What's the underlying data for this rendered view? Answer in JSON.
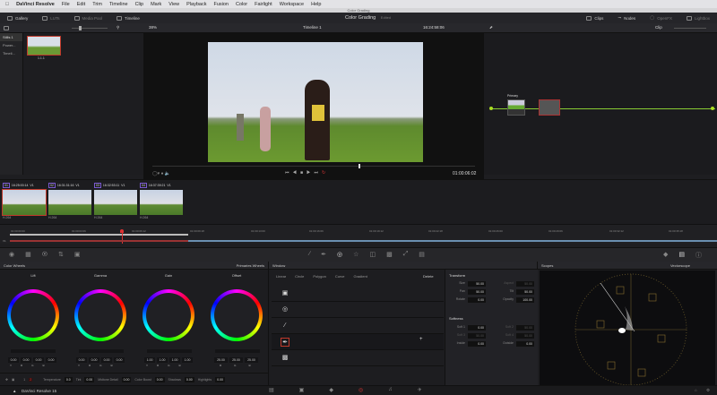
{
  "menu": {
    "app": "DaVinci Resolve",
    "items": [
      "File",
      "Edit",
      "Trim",
      "Timeline",
      "Clip",
      "Mark",
      "View",
      "Playback",
      "Fusion",
      "Color",
      "Fairlight",
      "Workspace",
      "Help"
    ]
  },
  "window_title": "Color Grading",
  "toolbar": {
    "left": [
      "Gallery",
      "LUTs",
      "Media Pool",
      "Timeline"
    ],
    "page_title": "Color Grading",
    "page_status": "Edited",
    "right": [
      "Clips",
      "Nodes",
      "OpenFX",
      "Lightbox"
    ]
  },
  "viewer_bar": {
    "zoom": "38%",
    "timeline": "Timeline 1",
    "timecode": "16:24:58:06",
    "clip_mode": "Clip"
  },
  "gallery": {
    "sidebar": [
      "Stills 1",
      "Power...",
      "Timeli..."
    ],
    "still_label": "1.1.1"
  },
  "viewer": {
    "timecode": "01:00:06:02"
  },
  "nodes": {
    "node1_label": "Primary"
  },
  "clips": [
    {
      "num": "01",
      "tc": "16:25:00:14",
      "track": "V1",
      "codec": "H.264"
    },
    {
      "num": "02",
      "tc": "16:31:31:16",
      "track": "V1",
      "codec": "H.264"
    },
    {
      "num": "03",
      "tc": "16:32:53:11",
      "track": "V1",
      "codec": "H.264"
    },
    {
      "num": "04",
      "tc": "16:37:39:21",
      "track": "V1",
      "codec": "H.264"
    }
  ],
  "ruler": {
    "track": "V1",
    "ticks": [
      "01:00:00:00",
      "01:00:03:06",
      "01:00:06:12",
      "01:00:09:18",
      "01:00:13:00",
      "01:00:16:06",
      "01:00:19:12",
      "01:00:22:18",
      "01:00:26:00",
      "01:00:29:06",
      "01:00:32:12",
      "01:00:35:18"
    ]
  },
  "color_wheels": {
    "title": "Color Wheels",
    "mode": "Primaries Wheels",
    "wheels": [
      {
        "name": "Lift",
        "values": [
          "0.00",
          "0.00",
          "0.00",
          "0.00"
        ],
        "channels": [
          "Y",
          "R",
          "G",
          "B"
        ]
      },
      {
        "name": "Gamma",
        "values": [
          "0.00",
          "0.00",
          "0.00",
          "0.00"
        ],
        "channels": [
          "Y",
          "R",
          "G",
          "B"
        ]
      },
      {
        "name": "Gain",
        "values": [
          "1.00",
          "1.00",
          "1.00",
          "1.00"
        ],
        "channels": [
          "Y",
          "R",
          "G",
          "B"
        ]
      },
      {
        "name": "Offset",
        "values": [
          "25.00",
          "25.00",
          "25.00"
        ],
        "channels": [
          "R",
          "G",
          "B"
        ]
      }
    ],
    "pages": [
      "1",
      "2"
    ],
    "params": [
      {
        "label": "Temperature",
        "value": "0.0"
      },
      {
        "label": "Tint",
        "value": "0.00"
      },
      {
        "label": "Midtone Detail",
        "value": "0.00"
      },
      {
        "label": "Color Boost",
        "value": "0.00"
      },
      {
        "label": "Shadows",
        "value": "0.00"
      },
      {
        "label": "Highlights",
        "value": "0.00"
      }
    ]
  },
  "window_panel": {
    "title": "Window",
    "tools": [
      "Linear",
      "Circle",
      "Polygon",
      "Curve",
      "Gradient"
    ],
    "delete": "Delete",
    "transform_title": "Transform",
    "transform": [
      {
        "label": "Size",
        "value": "50.00"
      },
      {
        "label": "Aspect",
        "value": "50.00"
      },
      {
        "label": "Pan",
        "value": "50.00"
      },
      {
        "label": "Tilt",
        "value": "50.00"
      },
      {
        "label": "Rotate",
        "value": "0.00"
      },
      {
        "label": "Opacity",
        "value": "100.00"
      }
    ],
    "softness_title": "Softness",
    "softness": [
      {
        "label": "Soft 1",
        "value": "0.00"
      },
      {
        "label": "Soft 2",
        "value": "50.00"
      },
      {
        "label": "Soft 3",
        "value": "50.00"
      },
      {
        "label": "Soft 4",
        "value": "50.00"
      },
      {
        "label": "Inside",
        "value": "0.00"
      },
      {
        "label": "Outside",
        "value": "0.00"
      }
    ]
  },
  "scopes": {
    "title": "Scopes",
    "mode": "Vectorscope"
  },
  "status": {
    "app": "DaVinci Resolve 15"
  }
}
